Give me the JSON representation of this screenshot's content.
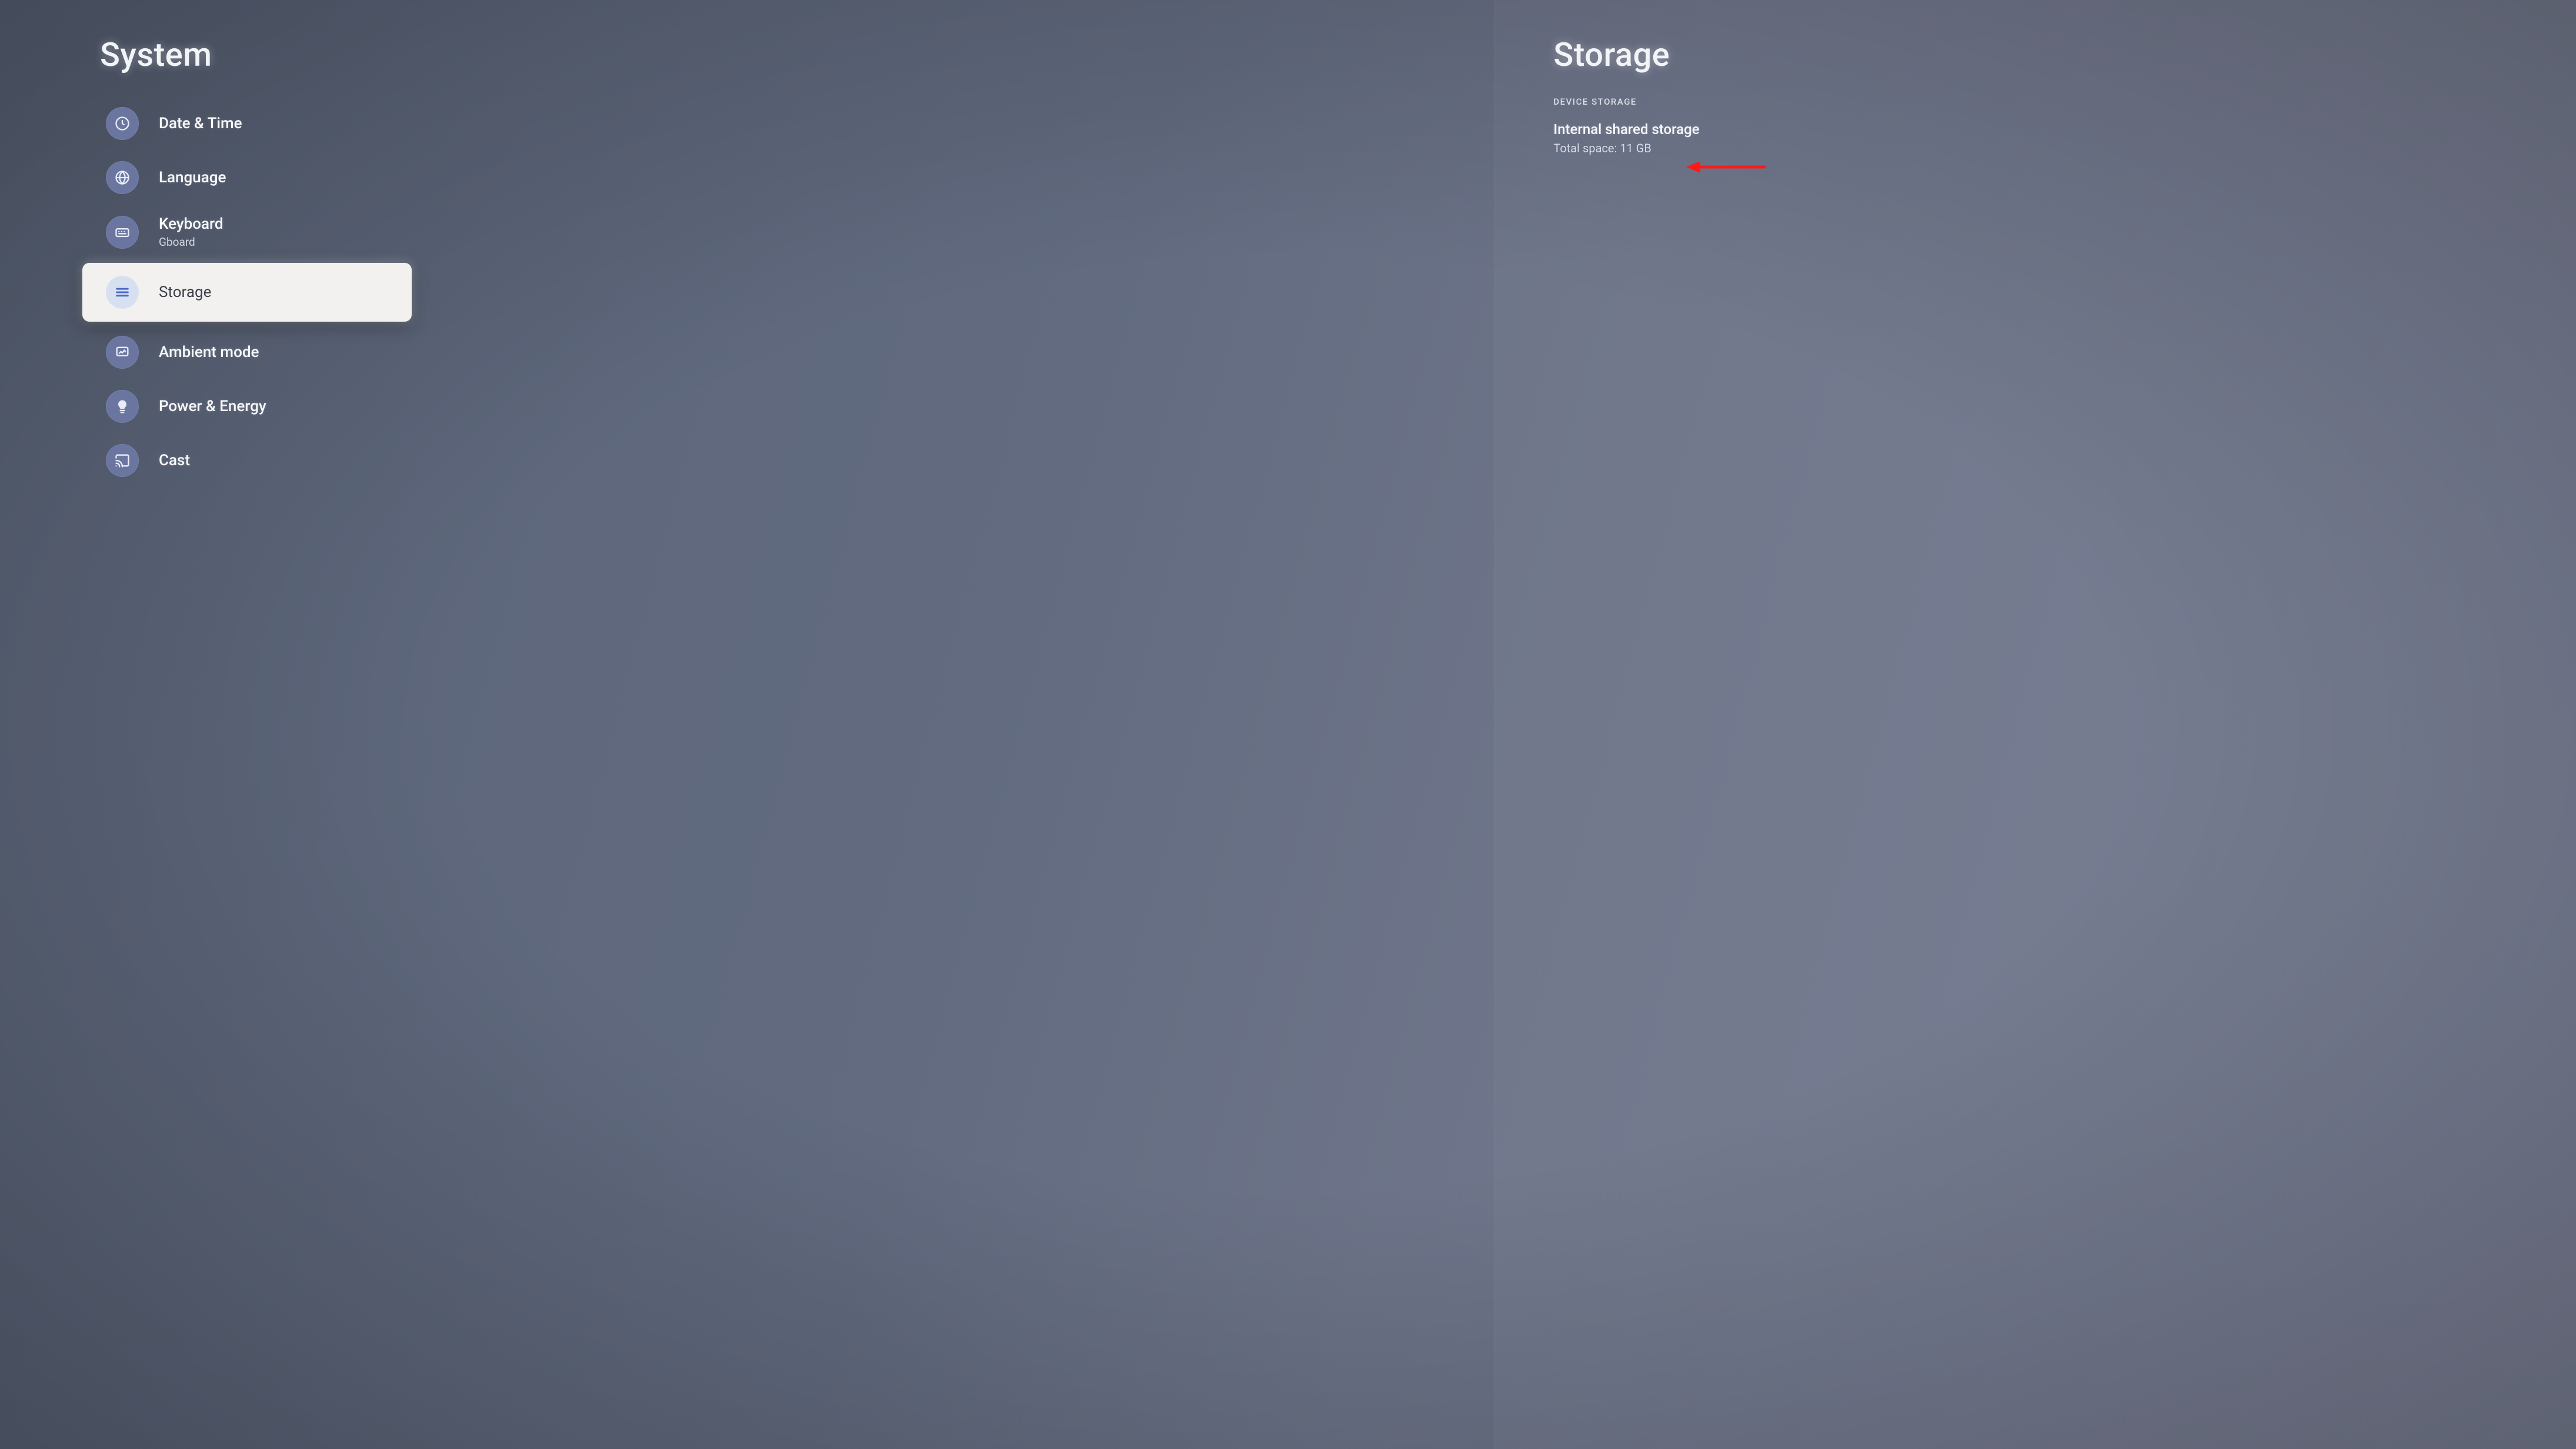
{
  "left": {
    "title": "System",
    "items": [
      {
        "icon": "clock",
        "label": "Date & Time",
        "sublabel": null,
        "selected": false
      },
      {
        "icon": "globe",
        "label": "Language",
        "sublabel": null,
        "selected": false
      },
      {
        "icon": "keyboard",
        "label": "Keyboard",
        "sublabel": "Gboard",
        "selected": false
      },
      {
        "icon": "storage",
        "label": "Storage",
        "sublabel": null,
        "selected": true
      },
      {
        "icon": "ambient",
        "label": "Ambient mode",
        "sublabel": null,
        "selected": false
      },
      {
        "icon": "power",
        "label": "Power & Energy",
        "sublabel": null,
        "selected": false
      },
      {
        "icon": "cast",
        "label": "Cast",
        "sublabel": null,
        "selected": false
      }
    ]
  },
  "right": {
    "title": "Storage",
    "section_header": "DEVICE STORAGE",
    "internal": {
      "title": "Internal shared storage",
      "subtitle": "Total space: 11 GB"
    }
  }
}
